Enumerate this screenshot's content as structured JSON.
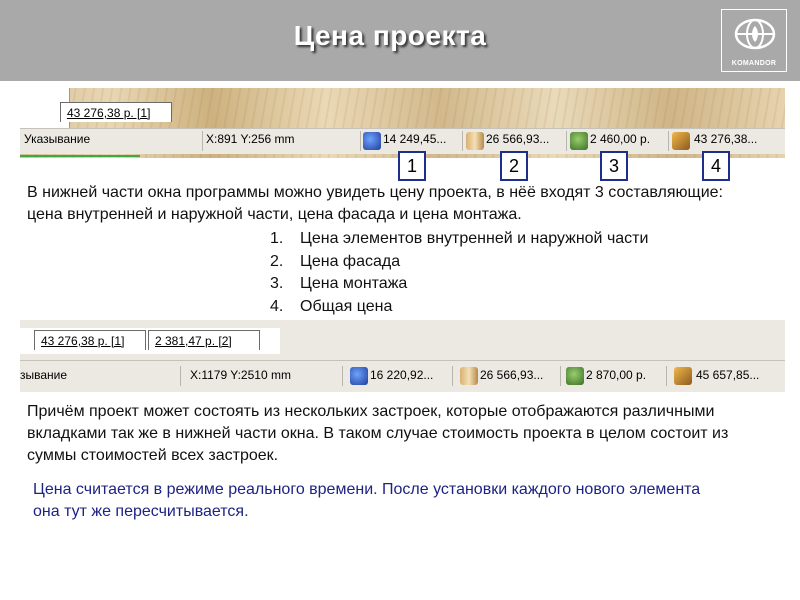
{
  "header": {
    "title": "Цена проекта",
    "logo_text": "KOMANDOR",
    "background_color": "#a9a9a9"
  },
  "strip1": {
    "tabs": [
      {
        "label": "43 276,38 р. [1]"
      }
    ],
    "status": {
      "mode": "Указывание",
      "coords": "X:891  Y:256  mm",
      "cells": [
        {
          "icon": "interior-price-icon",
          "value": "14 249,45..."
        },
        {
          "icon": "facade-price-icon",
          "value": "26 566,93..."
        },
        {
          "icon": "install-price-icon",
          "value": "2 460,00 р."
        },
        {
          "icon": "total-price-icon",
          "value": "43 276,38..."
        }
      ]
    }
  },
  "markers": [
    "1",
    "2",
    "3",
    "4"
  ],
  "intro_text": "В нижней части окна программы можно увидеть цену проекта, в нёё входят 3 составляющие: цена внутренней и наружной части, цена фасада и цена монтажа.",
  "components": [
    {
      "num": "1.",
      "text": "Цена элементов внутренней и наружной части"
    },
    {
      "num": "2.",
      "text": "Цена фасада"
    },
    {
      "num": "3.",
      "text": "Цена монтажа"
    },
    {
      "num": "4.",
      "text": "Общая цена"
    }
  ],
  "strip2": {
    "tabs": [
      {
        "label": "43 276,38 р. [1]"
      },
      {
        "label": "2 381,47 р. [2]"
      }
    ],
    "status": {
      "mode": "зывание",
      "coords": "X:1179  Y:2510  mm",
      "cells": [
        {
          "icon": "interior-price-icon",
          "value": "16 220,92..."
        },
        {
          "icon": "facade-price-icon",
          "value": "26 566,93..."
        },
        {
          "icon": "install-price-icon",
          "value": "2 870,00 р."
        },
        {
          "icon": "total-price-icon",
          "value": "45 657,85..."
        }
      ]
    }
  },
  "multi_text": "Причём проект может состоять из нескольких застроек, которые отображаются различными вкладками так же в нижней части окна. В таком случае стоимость проекта в целом состоит из суммы стоимостей всех застроек.",
  "realtime_text": "Цена считается в режиме реального времени. После установки каждого нового элемента она тут же пересчитывается.",
  "colors": {
    "accent_blue": "#1d2f8c",
    "realtime_text": "#1d2384"
  }
}
